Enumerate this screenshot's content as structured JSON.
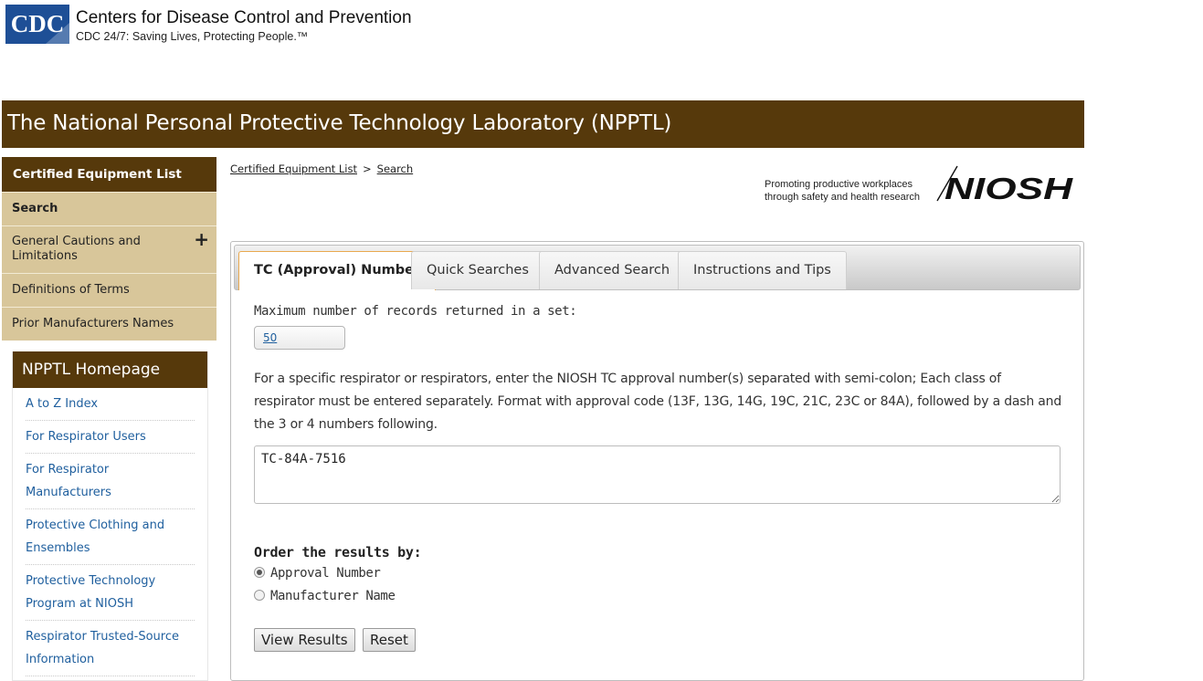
{
  "header": {
    "logo_text": "CDC",
    "org_name": "Centers for Disease Control and Prevention",
    "tagline": "CDC 24/7: Saving Lives, Protecting People.™"
  },
  "banner": {
    "title": "The National Personal Protective Technology Laboratory (NPPTL)"
  },
  "leftnav": {
    "heading": "Certified Equipment List",
    "items": [
      {
        "label": "Search"
      },
      {
        "label": "General Cautions and Limitations",
        "expand": "+"
      },
      {
        "label": "Definitions of Terms"
      },
      {
        "label": "Prior Manufacturers Names"
      }
    ]
  },
  "homebox": {
    "heading": "NPPTL Homepage",
    "links": [
      {
        "label": "A to Z Index"
      },
      {
        "label": "For Respirator Users"
      },
      {
        "label": "For Respirator Manufacturers"
      },
      {
        "label": "Protective Clothing and Ensembles"
      },
      {
        "label": "Protective Technology Program at NIOSH"
      },
      {
        "label": "Respirator Trusted-Source Information"
      }
    ]
  },
  "breadcrumb": {
    "items": [
      "Certified Equipment List",
      "Search"
    ],
    "separator": ">"
  },
  "niosh": {
    "line1": "Promoting productive workplaces",
    "line2": "through safety and health research",
    "logo_text": "NIOSH"
  },
  "tabs": [
    {
      "label": "TC (Approval) Number",
      "active": true
    },
    {
      "label": "Quick Searches"
    },
    {
      "label": "Advanced Search"
    },
    {
      "label": "Instructions and Tips"
    }
  ],
  "form": {
    "max_records_label": "Maximum number of records returned in a set:",
    "max_records_value": "50",
    "instructions": "For a specific respirator or respirators, enter the NIOSH TC approval number(s) separated with semi-colon; Each class of respirator must be entered separately. Format with approval code (13F, 13G, 14G, 19C, 21C, 23C or 84A), followed by a dash and the 3 or 4 numbers following.",
    "tc_value": "TC-84A-7516",
    "order_label": "Order the results by:",
    "order_options": [
      {
        "label": "Approval Number",
        "selected": true
      },
      {
        "label": "Manufacturer Name",
        "selected": false
      }
    ],
    "view_results_label": "View Results",
    "reset_label": "Reset"
  },
  "colors": {
    "brand_brown": "#56390b",
    "nav_tan": "#d8c69a",
    "link_blue": "#1f5f9e",
    "tab_active_border": "#e9a94e"
  }
}
